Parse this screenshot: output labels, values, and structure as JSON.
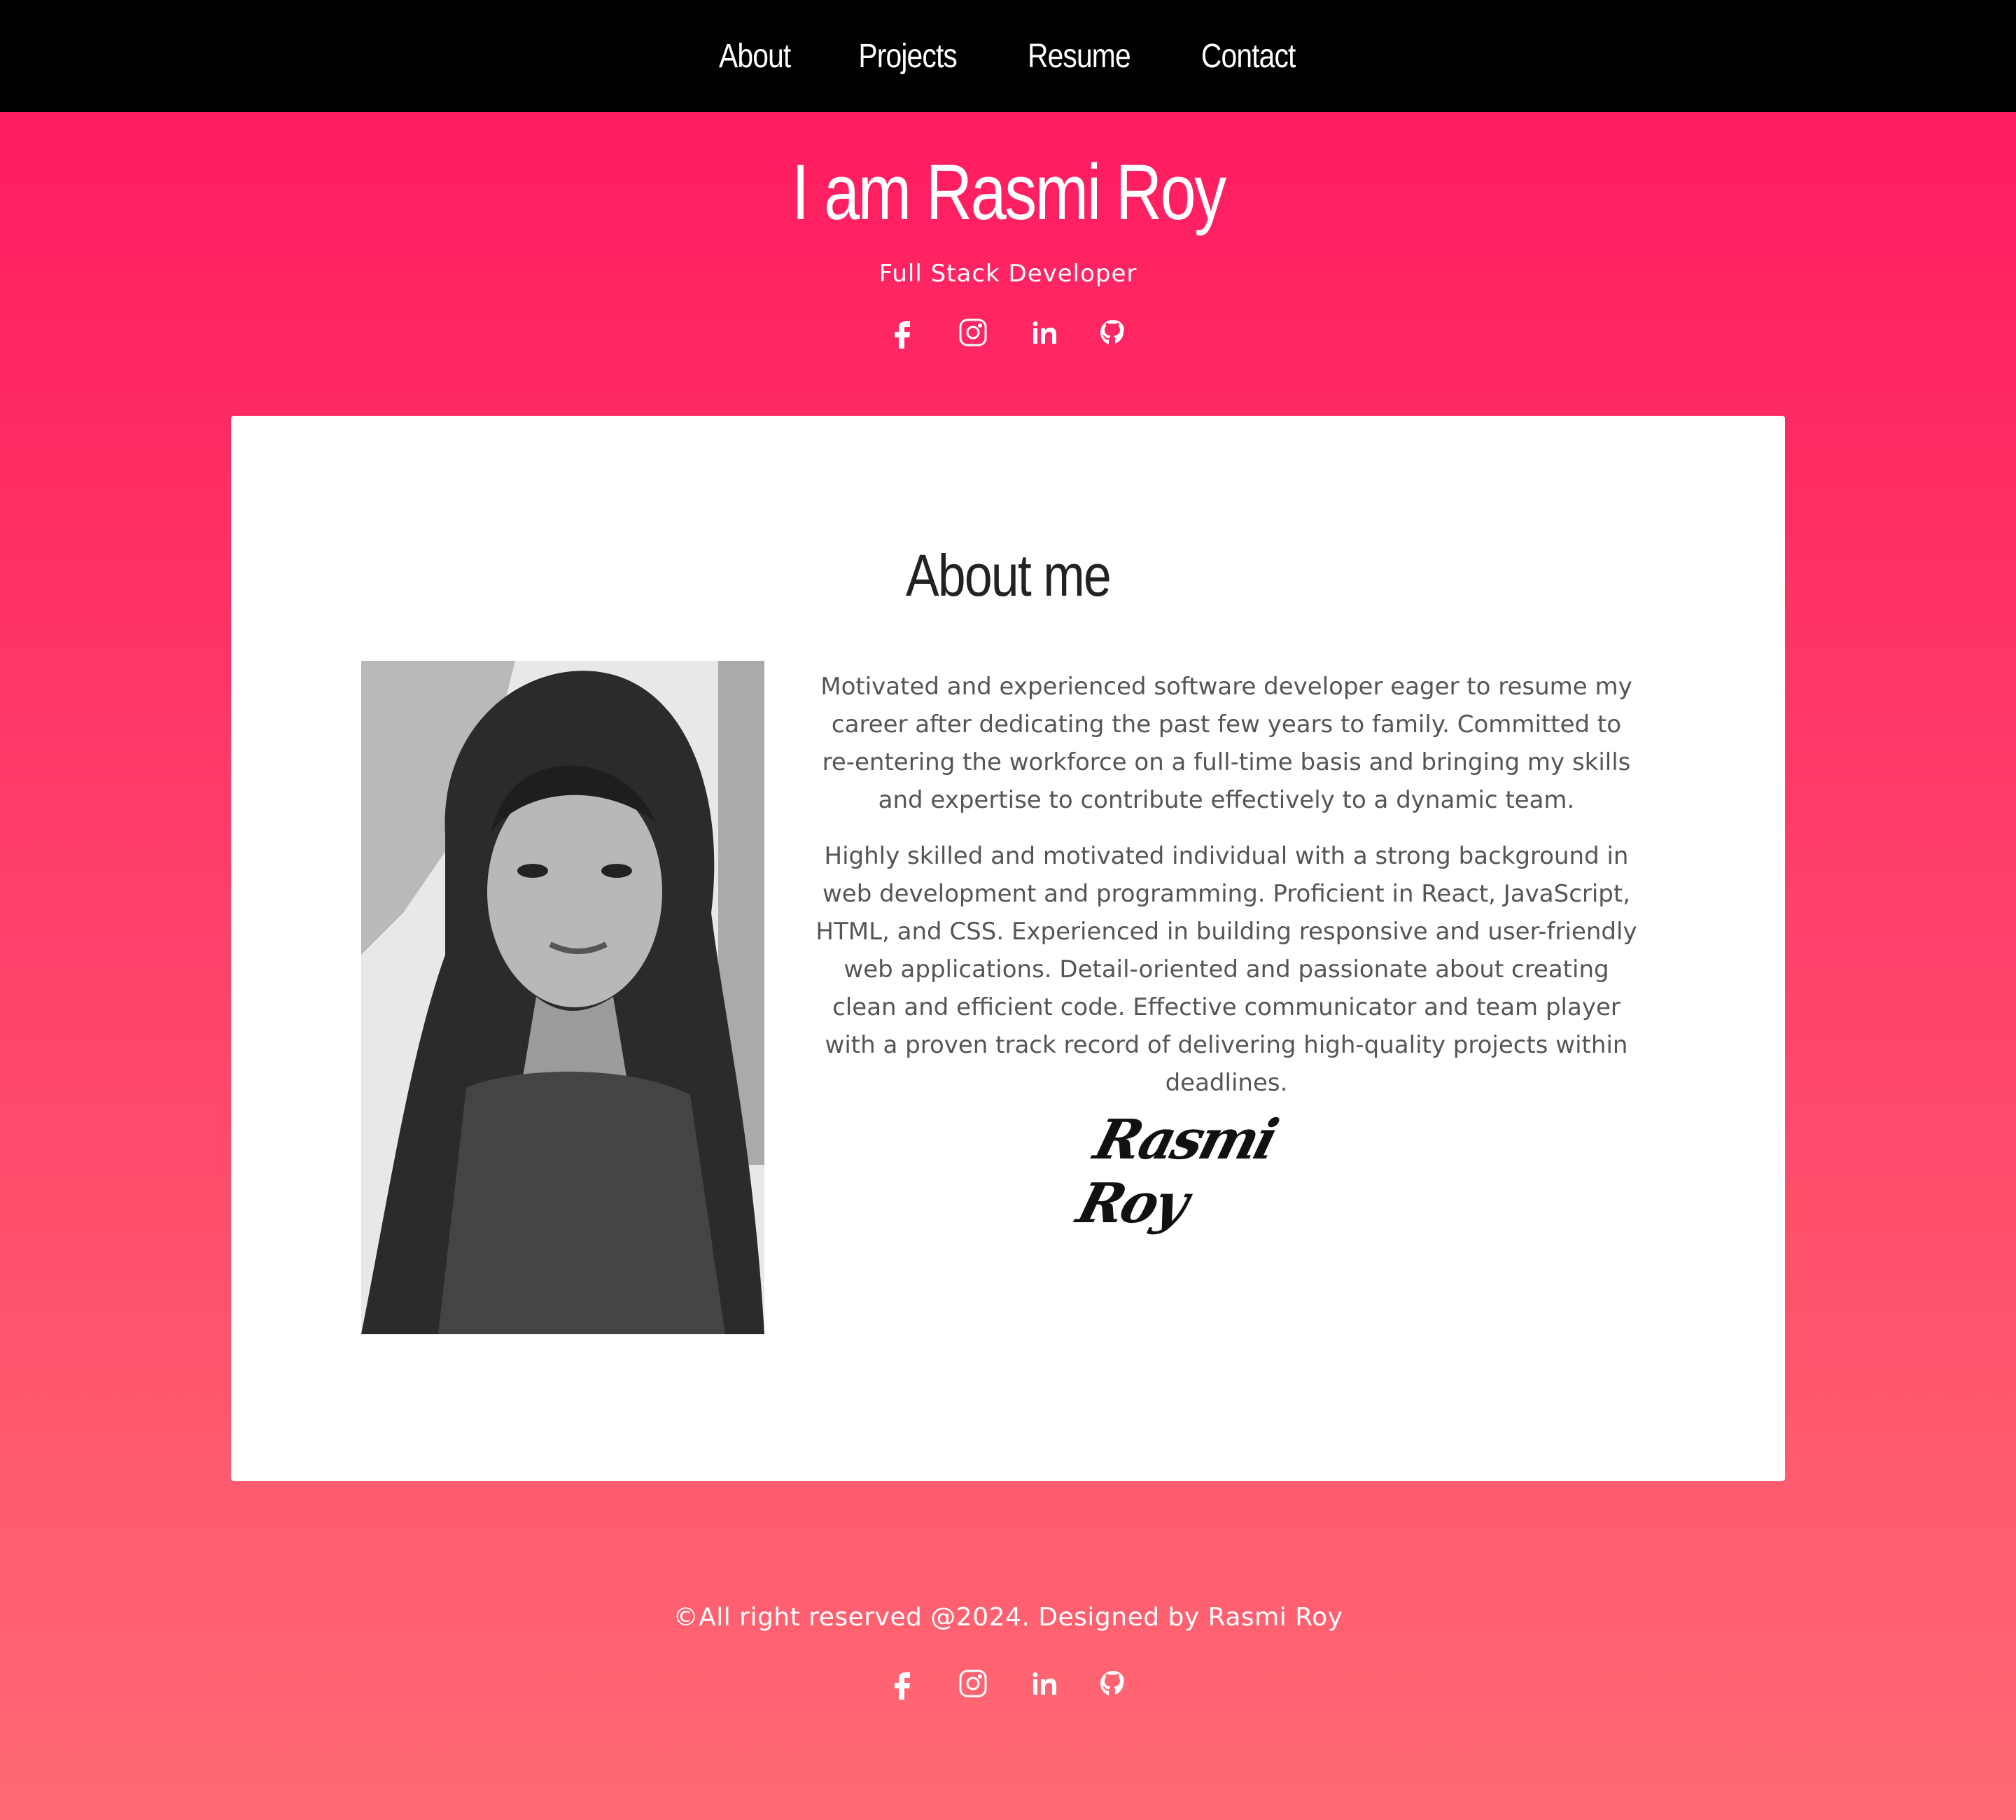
{
  "nav": {
    "items": [
      {
        "label": "About"
      },
      {
        "label": "Projects"
      },
      {
        "label": "Resume"
      },
      {
        "label": "Contact"
      }
    ]
  },
  "hero": {
    "title": "I am Rasmi Roy",
    "subtitle": "Full Stack Developer",
    "socials": [
      {
        "icon": "facebook-icon"
      },
      {
        "icon": "instagram-icon"
      },
      {
        "icon": "linkedin-icon"
      },
      {
        "icon": "github-icon"
      }
    ]
  },
  "about": {
    "heading": "About me",
    "paragraphs": [
      "Motivated and experienced software developer eager to resume my career after dedicating the past few years to family. Committed to re-entering the workforce on a full-time basis and bringing my skills and expertise to contribute effectively to a dynamic team.",
      "Highly skilled and motivated individual with a strong background in web development and programming. Proficient in React, JavaScript, HTML, and CSS. Experienced in building responsive and user-friendly web applications. Detail-oriented and passionate about creating clean and efficient code. Effective communicator and team player with a proven track record of delivering high-quality projects within deadlines."
    ],
    "signature": "Rasmi Roy"
  },
  "footer": {
    "copyright": "©All right reserved @2024. Designed by Rasmi Roy",
    "socials": [
      {
        "icon": "facebook-icon"
      },
      {
        "icon": "instagram-icon"
      },
      {
        "icon": "linkedin-icon"
      },
      {
        "icon": "github-icon"
      }
    ]
  },
  "colors": {
    "nav_bg": "#000000",
    "gradient_top": "#ff175f",
    "gradient_bottom": "#ff6a73",
    "card_bg": "#ffffff",
    "body_text": "#555555",
    "heading_text": "#222222"
  }
}
